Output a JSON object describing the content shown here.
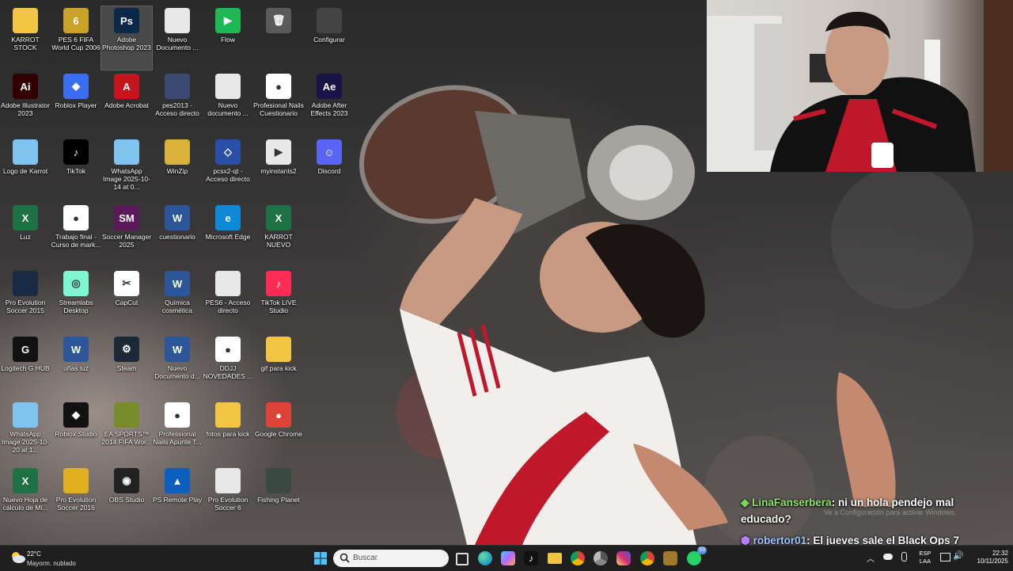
{
  "desktop": {
    "icons": [
      {
        "label": "KARROT STOCK",
        "glyph": "",
        "color": "#f4c542"
      },
      {
        "label": "PES 6 FIFA World Cup 2006",
        "glyph": "6",
        "color": "#c9a227"
      },
      {
        "label": "Adobe Photoshop 2023",
        "glyph": "Ps",
        "color": "#0b2a4a"
      },
      {
        "label": "Nuevo Documento ...",
        "glyph": "",
        "color": "#e8e8e8"
      },
      {
        "label": "Flow",
        "glyph": "▶",
        "color": "#1db954"
      },
      {
        "label": "",
        "glyph": "🗑",
        "color": "#5a5a5a"
      },
      {
        "label": "Configurar",
        "glyph": "",
        "color": "#444"
      },
      {
        "label": "Adobe Illustrator 2023",
        "glyph": "Ai",
        "color": "#330000"
      },
      {
        "label": "Roblox Player",
        "glyph": "◆",
        "color": "#3a6df0"
      },
      {
        "label": "Adobe Acrobat",
        "glyph": "A",
        "color": "#c4161c"
      },
      {
        "label": "pes2013 - Acceso directo",
        "glyph": "",
        "color": "#3b4b73"
      },
      {
        "label": "Nuevo documento ...",
        "glyph": "",
        "color": "#e8e8e8"
      },
      {
        "label": "Profesional Nails Cuestionario",
        "glyph": "●",
        "color": "#ffffff"
      },
      {
        "label": "Adobe After Effects 2023",
        "glyph": "Ae",
        "color": "#1a1348"
      },
      {
        "label": "Logo de Karrot",
        "glyph": "",
        "color": "#7fc3f0"
      },
      {
        "label": "TikTok",
        "glyph": "♪",
        "color": "#000"
      },
      {
        "label": "WhatsApp Image 2025-10-14 at 0...",
        "glyph": "",
        "color": "#7fc3f0"
      },
      {
        "label": "WinZip",
        "glyph": "",
        "color": "#d9b23a"
      },
      {
        "label": "pcsx2-qt - Acceso directo",
        "glyph": "◇",
        "color": "#2a4fa8"
      },
      {
        "label": "myinstants2",
        "glyph": "▶",
        "color": "#e8e8e8"
      },
      {
        "label": "Discord",
        "glyph": "☺",
        "color": "#5865f2"
      },
      {
        "label": "Luz",
        "glyph": "X",
        "color": "#1e7145"
      },
      {
        "label": "Trabajo final - Curso de mark...",
        "glyph": "●",
        "color": "#ffffff"
      },
      {
        "label": "Soccer Manager 2025",
        "glyph": "SM",
        "color": "#5a1a5a"
      },
      {
        "label": "cuestionario",
        "glyph": "W",
        "color": "#2b579a"
      },
      {
        "label": "Microsoft Edge",
        "glyph": "e",
        "color": "#0c8ad8"
      },
      {
        "label": "KARROT NUEVO",
        "glyph": "X",
        "color": "#1e7145"
      },
      {
        "label": "Pro Evolution Soccer 2015",
        "glyph": "",
        "color": "#1a2a44"
      },
      {
        "label": "Streamlabs Desktop",
        "glyph": "◎",
        "color": "#80f5d2"
      },
      {
        "label": "CapCut",
        "glyph": "✂",
        "color": "#ffffff"
      },
      {
        "label": "Química cosmética",
        "glyph": "W",
        "color": "#2b579a"
      },
      {
        "label": "PES6 - Acceso directo",
        "glyph": "",
        "color": "#e8e8e8"
      },
      {
        "label": "TikTok LIVE Studio",
        "glyph": "♪",
        "color": "#fe2c55"
      },
      {
        "label": "Logitech G HUB",
        "glyph": "G",
        "color": "#111"
      },
      {
        "label": "uñas luz",
        "glyph": "W",
        "color": "#2b579a"
      },
      {
        "label": "Steam",
        "glyph": "⚙",
        "color": "#1b2838"
      },
      {
        "label": "Nuevo Documento d...",
        "glyph": "W",
        "color": "#2b579a"
      },
      {
        "label": "DDJJ NOVEDADES ...",
        "glyph": "●",
        "color": "#ffffff"
      },
      {
        "label": "gif para kick",
        "glyph": "",
        "color": "#f4c542"
      },
      {
        "label": "WhatsApp Image 2025-10-20 at 1...",
        "glyph": "",
        "color": "#7fc3f0"
      },
      {
        "label": "Roblox Studio",
        "glyph": "◆",
        "color": "#111"
      },
      {
        "label": "EA SPORTS™ 2014 FIFA Wor...",
        "glyph": "",
        "color": "#7a8b2a"
      },
      {
        "label": "Professional Nails Apunte T...",
        "glyph": "●",
        "color": "#ffffff"
      },
      {
        "label": "fotos para kick",
        "glyph": "",
        "color": "#f4c542"
      },
      {
        "label": "Google Chrome",
        "glyph": "●",
        "color": "#db4437"
      },
      {
        "label": "Nuevo Hoja de cálculo de Mi...",
        "glyph": "X",
        "color": "#1e7145"
      },
      {
        "label": "Pro Evolution Soccer 2016",
        "glyph": "",
        "color": "#e0b020"
      },
      {
        "label": "OBS Studio",
        "glyph": "◉",
        "color": "#222"
      },
      {
        "label": "PS Remote Play",
        "glyph": "▲",
        "color": "#0b5fbf"
      },
      {
        "label": "Pro Evolution Soccer 6",
        "glyph": "",
        "color": "#e8e8e8"
      },
      {
        "label": "Fishing Planet",
        "glyph": "",
        "color": "#3b4a40"
      }
    ]
  },
  "chat": {
    "messages": [
      {
        "user": "LinaFanserbera",
        "text": ": ni un hola pendejo mal educado?",
        "badge": "◆"
      },
      {
        "user": "robertor01",
        "text": ": El jueves sale el Black Ops 7",
        "badge": "⬢"
      }
    ],
    "watermark": "Ve a Configuración para activar Windows."
  },
  "taskbar": {
    "weather_temp": "22°C",
    "weather_desc": "Mayorm. nublado",
    "search_placeholder": "Buscar",
    "lang_1": "ESP",
    "lang_2": "LAA",
    "time": "22:32",
    "date": "10/11/2025",
    "whatsapp_badge": "59"
  }
}
